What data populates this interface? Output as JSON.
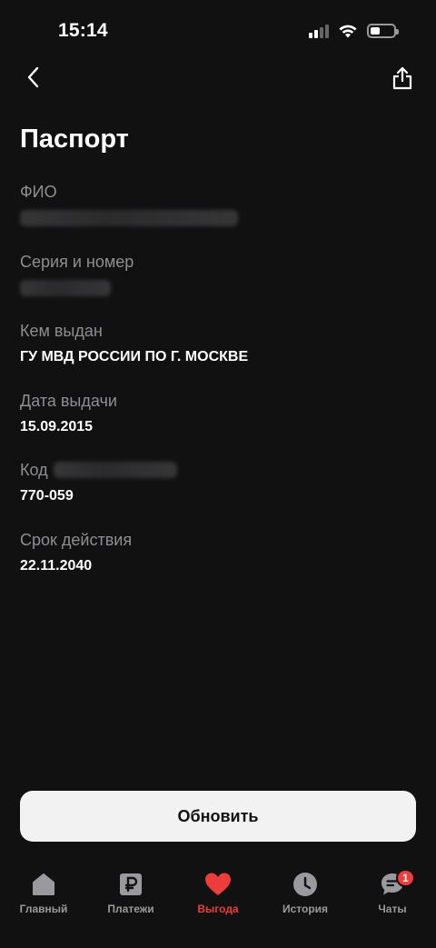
{
  "status_bar": {
    "time": "15:14",
    "battery_level": 0.4
  },
  "page": {
    "title": "Паспорт"
  },
  "fields": [
    {
      "label": "ФИО",
      "value": ""
    },
    {
      "label": "Серия и номер",
      "value": ""
    },
    {
      "label": "Кем выдан",
      "value": "ГУ МВД РОССИИ ПО Г. МОСКВЕ"
    },
    {
      "label": "Дата выдачи",
      "value": "15.09.2015"
    },
    {
      "label": "Код",
      "value": "770-059"
    },
    {
      "label": "Срок действия",
      "value": "22.11.2040"
    }
  ],
  "actions": {
    "refresh_label": "Обновить"
  },
  "tab_bar": {
    "active": "Выгода",
    "items": [
      {
        "label": "Главный",
        "icon": "home-icon"
      },
      {
        "label": "Платежи",
        "icon": "ruble-icon"
      },
      {
        "label": "Выгода",
        "icon": "heart-icon"
      },
      {
        "label": "История",
        "icon": "clock-icon"
      },
      {
        "label": "Чаты",
        "icon": "chat-icon",
        "badge": "1"
      }
    ]
  },
  "colors": {
    "background": "#111111",
    "accent": "#ee3b3b",
    "muted": "#8e8e93",
    "button": "#f2f2f2"
  }
}
